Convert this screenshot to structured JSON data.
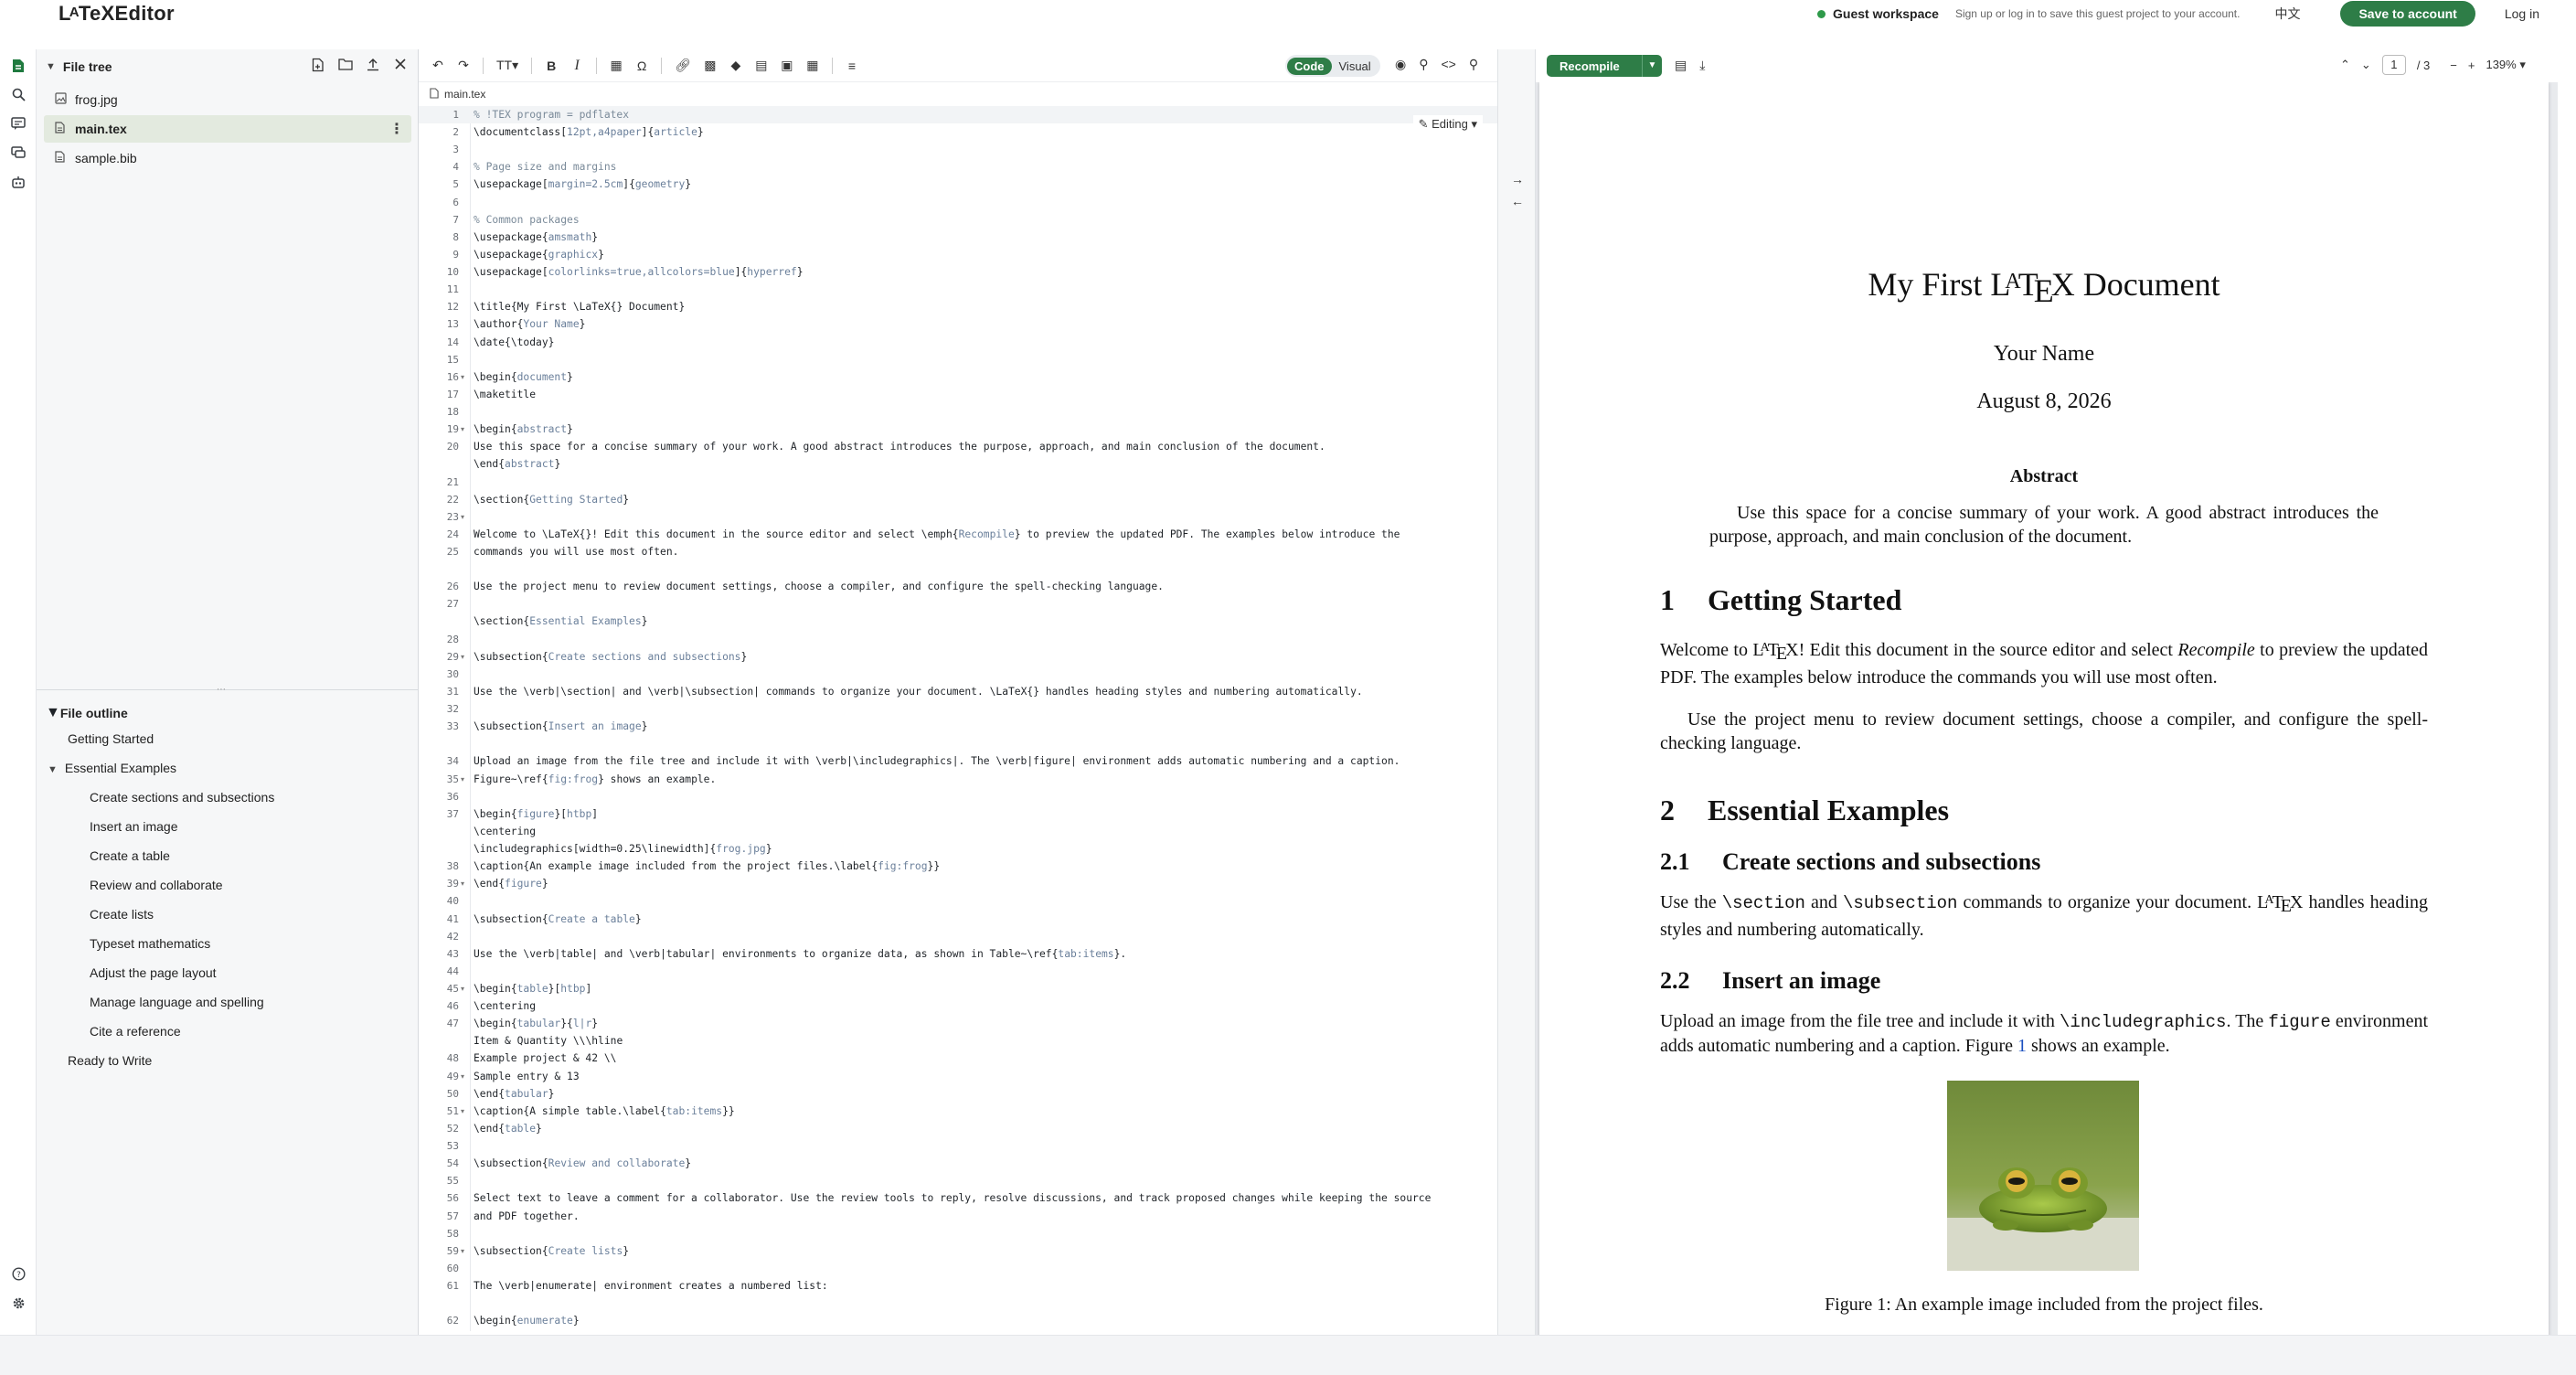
{
  "brand": "LaTeXEditor",
  "topbar": {
    "guest_label": "Guest workspace",
    "guest_hint": "Sign up or log in to save this guest project to your account.",
    "language": "中文",
    "save_button": "Save to account",
    "login": "Log in"
  },
  "sidebar": {
    "file_tree_title": "File tree",
    "files": [
      {
        "name": "frog.jpg",
        "icon": "image-icon"
      },
      {
        "name": "main.tex",
        "icon": "file-icon"
      },
      {
        "name": "sample.bib",
        "icon": "file-icon"
      }
    ],
    "outline_title": "File outline",
    "outline": [
      {
        "label": "Getting Started",
        "level": 1
      },
      {
        "label": "Essential Examples",
        "level": 1
      },
      {
        "label": "Create sections and subsections",
        "level": 2
      },
      {
        "label": "Insert an image",
        "level": 2
      },
      {
        "label": "Create a table",
        "level": 2
      },
      {
        "label": "Review and collaborate",
        "level": 2
      },
      {
        "label": "Create lists",
        "level": 2
      },
      {
        "label": "Typeset mathematics",
        "level": 2
      },
      {
        "label": "Adjust the page layout",
        "level": 2
      },
      {
        "label": "Manage language and spelling",
        "level": 2
      },
      {
        "label": "Cite a reference",
        "level": 2
      },
      {
        "label": "Ready to Write",
        "level": 1
      }
    ]
  },
  "editor": {
    "mode_code": "Code",
    "mode_visual": "Visual",
    "tab_name": "main.tex",
    "editing_label": "Editing",
    "lines": [
      {
        "n": "1",
        "t": "% !TEX program = pdflatex",
        "c": true
      },
      {
        "n": "2",
        "t": "\\documentclass[12pt,a4paper]{article}"
      },
      {
        "n": "3",
        "t": ""
      },
      {
        "n": "4",
        "t": "% Page size and margins"
      },
      {
        "n": "5",
        "t": "\\usepackage[margin=2.5cm]{geometry}"
      },
      {
        "n": "6",
        "t": ""
      },
      {
        "n": "7",
        "t": "% Common packages"
      },
      {
        "n": "8",
        "t": "\\usepackage{amsmath}"
      },
      {
        "n": "9",
        "t": "\\usepackage{graphicx}"
      },
      {
        "n": "10",
        "t": "\\usepackage[colorlinks=true,allcolors=blue]{hyperref}"
      },
      {
        "n": "11",
        "t": ""
      },
      {
        "n": "12",
        "t": "\\title{My First \\LaTeX{} Document}"
      },
      {
        "n": "13",
        "t": "\\author{Your Name}"
      },
      {
        "n": "14",
        "t": "\\date{\\today}"
      },
      {
        "n": "15",
        "t": ""
      },
      {
        "n": "16",
        "t": "\\begin{document}",
        "f": true
      },
      {
        "n": "17",
        "t": "\\maketitle"
      },
      {
        "n": "18",
        "t": ""
      },
      {
        "n": "19",
        "t": "\\begin{abstract}",
        "f": true
      },
      {
        "n": "20",
        "t": "Use this space for a concise summary of your work. A good abstract introduces the purpose, approach, and main conclusion of the document."
      },
      {
        "n": "",
        "t": "\\end{abstract}"
      },
      {
        "n": "21",
        "t": ""
      },
      {
        "n": "22",
        "t": "\\section{Getting Started}"
      },
      {
        "n": "23",
        "t": "",
        "f": true
      },
      {
        "n": "24",
        "t": "Welcome to \\LaTeX{}! Edit this document in the source editor and select \\emph{Recompile} to preview the updated PDF. The examples below introduce the"
      },
      {
        "n": "25",
        "t": "commands you will use most often."
      },
      {
        "n": "",
        "t": ""
      },
      {
        "n": "26",
        "t": "Use the project menu to review document settings, choose a compiler, and configure the spell-checking language."
      },
      {
        "n": "27",
        "t": ""
      },
      {
        "n": "",
        "t": "\\section{Essential Examples}"
      },
      {
        "n": "28",
        "t": ""
      },
      {
        "n": "29",
        "t": "\\subsection{Create sections and subsections}",
        "f": true
      },
      {
        "n": "30",
        "t": ""
      },
      {
        "n": "31",
        "t": "Use the \\verb|\\section| and \\verb|\\subsection| commands to organize your document. \\LaTeX{} handles heading styles and numbering automatically."
      },
      {
        "n": "32",
        "t": ""
      },
      {
        "n": "33",
        "t": "\\subsection{Insert an image}"
      },
      {
        "n": "",
        "t": ""
      },
      {
        "n": "34",
        "t": "Upload an image from the file tree and include it with \\verb|\\includegraphics|. The \\verb|figure| environment adds automatic numbering and a caption."
      },
      {
        "n": "35",
        "t": "Figure~\\ref{fig:frog} shows an example.",
        "f": true
      },
      {
        "n": "36",
        "t": ""
      },
      {
        "n": "37",
        "t": "\\begin{figure}[htbp]"
      },
      {
        "n": "",
        "t": "\\centering"
      },
      {
        "n": "",
        "t": "\\includegraphics[width=0.25\\linewidth]{frog.jpg}"
      },
      {
        "n": "38",
        "t": "\\caption{An example image included from the project files.\\label{fig:frog}}"
      },
      {
        "n": "39",
        "t": "\\end{figure}",
        "f": true
      },
      {
        "n": "40",
        "t": ""
      },
      {
        "n": "41",
        "t": "\\subsection{Create a table}"
      },
      {
        "n": "42",
        "t": ""
      },
      {
        "n": "43",
        "t": "Use the \\verb|table| and \\verb|tabular| environments to organize data, as shown in Table~\\ref{tab:items}."
      },
      {
        "n": "44",
        "t": ""
      },
      {
        "n": "45",
        "t": "\\begin{table}[htbp]",
        "f": true
      },
      {
        "n": "46",
        "t": "\\centering"
      },
      {
        "n": "47",
        "t": "\\begin{tabular}{l|r}"
      },
      {
        "n": "",
        "t": "Item & Quantity \\\\\\hline"
      },
      {
        "n": "48",
        "t": "Example project & 42 \\\\"
      },
      {
        "n": "49",
        "t": "Sample entry & 13",
        "f": true
      },
      {
        "n": "50",
        "t": "\\end{tabular}"
      },
      {
        "n": "51",
        "t": "\\caption{A simple table.\\label{tab:items}}",
        "f": true
      },
      {
        "n": "52",
        "t": "\\end{table}"
      },
      {
        "n": "53",
        "t": ""
      },
      {
        "n": "54",
        "t": "\\subsection{Review and collaborate}"
      },
      {
        "n": "55",
        "t": ""
      },
      {
        "n": "56",
        "t": "Select text to leave a comment for a collaborator. Use the review tools to reply, resolve discussions, and track proposed changes while keeping the source"
      },
      {
        "n": "57",
        "t": "and PDF together."
      },
      {
        "n": "58",
        "t": ""
      },
      {
        "n": "59",
        "t": "\\subsection{Create lists}",
        "f": true
      },
      {
        "n": "60",
        "t": ""
      },
      {
        "n": "61",
        "t": "The \\verb|enumerate| environment creates a numbered list:"
      },
      {
        "n": "",
        "t": ""
      },
      {
        "n": "62",
        "t": "\\begin{enumerate}"
      }
    ]
  },
  "pdf": {
    "recompile": "Recompile",
    "page_current": "1",
    "page_total": "/ 3",
    "zoom": "139%",
    "title_pre": "My First ",
    "title_post": " Document",
    "author": "Your Name",
    "date": "August 8, 2026",
    "abstract_heading": "Abstract",
    "abstract_text": "Use this space for a concise summary of your work. A good abstract introduces the purpose, approach, and main conclusion of the document.",
    "s1_num": "1",
    "s1_title": "Getting Started",
    "p1a": "Welcome to ",
    "p1b": "! Edit this document in the source editor and select ",
    "p1c": "Recompile",
    "p1d": " to preview the updated PDF. The examples below introduce the commands you will use most often.",
    "p2": "Use the project menu to review document settings, choose a compiler, and configure the spell-checking language.",
    "s2_num": "2",
    "s2_title": "Essential Examples",
    "s21_num": "2.1",
    "s21_title": "Create sections and subsections",
    "p3a": "Use the ",
    "p3b": "\\section",
    "p3c": " and ",
    "p3d": "\\subsection",
    "p3e": " commands to organize your document. ",
    "p3f": " handles heading styles and numbering automatically.",
    "s22_num": "2.2",
    "s22_title": "Insert an image",
    "p4a": "Upload an image from the file tree and include it with ",
    "p4b": "\\includegraphics",
    "p4c": ". The ",
    "p4d": "figure",
    "p4e": " environment adds automatic numbering and a caption. Figure ",
    "p4f": "1",
    "p4g": " shows an example.",
    "caption": "Figure 1: An example image included from the project files."
  },
  "colors": {
    "accent": "#2e7d47",
    "link": "#1a4fbf",
    "comment": "#7a8a99",
    "command": "#1f2328",
    "arg": "#6a7f9a"
  }
}
